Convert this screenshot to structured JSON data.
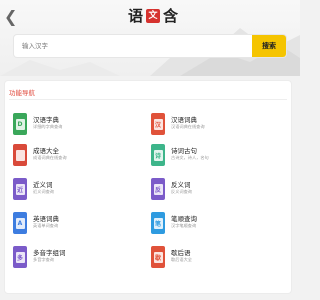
{
  "header": {
    "logo_chars": [
      "语",
      "文",
      "含"
    ],
    "search_placeholder": "输入汉字",
    "search_button": "搜索"
  },
  "nav": {
    "title": "功能导航",
    "items": [
      {
        "title": "汉语字典",
        "desc": "详细的字典查询",
        "icon": "d-icon",
        "glyph": "D",
        "color": "#3aa75a"
      },
      {
        "title": "汉语词典",
        "desc": "汉语词典在线查询",
        "icon": "han-icon",
        "glyph": "汉",
        "color": "#e0523a"
      },
      {
        "title": "成语大全",
        "desc": "成语词典在线查询",
        "icon": "book-icon",
        "glyph": "",
        "color": "#d94a3a"
      },
      {
        "title": "诗词古句",
        "desc": "古诗文，诗人，名句",
        "icon": "poem-icon",
        "glyph": "诗",
        "color": "#3db58a"
      },
      {
        "title": "近义词",
        "desc": "近义词查询",
        "icon": "synonym-icon",
        "glyph": "近",
        "color": "#7b5bc9"
      },
      {
        "title": "反义词",
        "desc": "反义词查询",
        "icon": "antonym-icon",
        "glyph": "反",
        "color": "#7b5bc9"
      },
      {
        "title": "英语词典",
        "desc": "英语单词查询",
        "icon": "english-icon",
        "glyph": "A",
        "color": "#3d7de0"
      },
      {
        "title": "笔顺查询",
        "desc": "汉字笔顺查询",
        "icon": "stroke-icon",
        "glyph": "笔",
        "color": "#2e9be0"
      },
      {
        "title": "多音字组词",
        "desc": "多音字查询",
        "icon": "polyphone-icon",
        "glyph": "多",
        "color": "#7b5bc9"
      },
      {
        "title": "歇后语",
        "desc": "歇后语大全",
        "icon": "xiehouyu-icon",
        "glyph": "歇",
        "color": "#e0523a"
      }
    ]
  }
}
